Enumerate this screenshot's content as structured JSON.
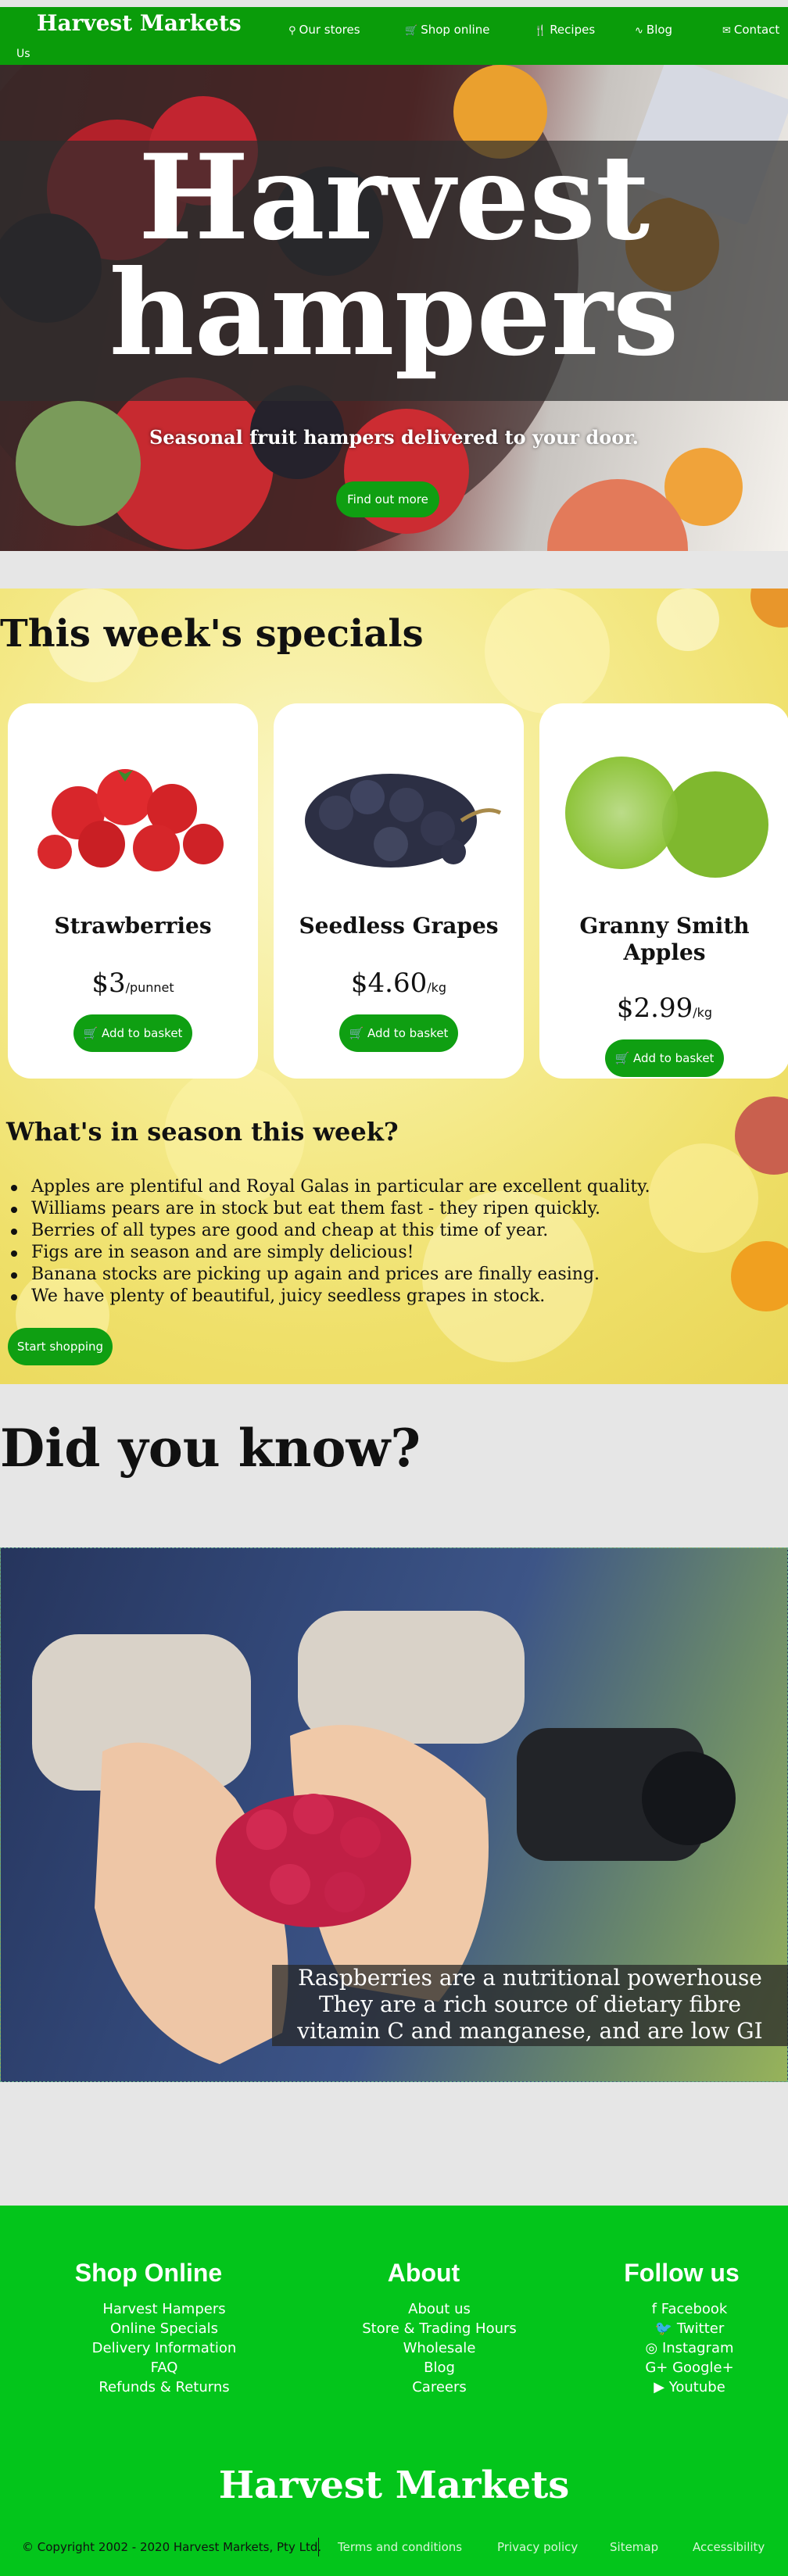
{
  "nav": {
    "brand": "Harvest Markets",
    "links": [
      {
        "label": "Our stores",
        "icon": "map-marker-icon",
        "glyph": "⚲"
      },
      {
        "label": "Shop online",
        "icon": "basket-icon",
        "glyph": "🛒"
      },
      {
        "label": "Recipes",
        "icon": "cutlery-icon",
        "glyph": "🍴"
      },
      {
        "label": "Blog",
        "icon": "rss-icon",
        "glyph": "∿"
      },
      {
        "label": "Contact",
        "icon": "envelope-icon",
        "glyph": "✉"
      }
    ],
    "contact_wrap": "Us"
  },
  "hero": {
    "title_line1": "Harvest",
    "title_line2": "hampers",
    "subtitle": "Seasonal fruit hampers delivered to your door.",
    "cta": "Find out more"
  },
  "specials": {
    "heading": "This week's specials",
    "cards": [
      {
        "name_line1": "Strawberries",
        "name_line2": "",
        "price": "$3",
        "unit": "/punnet",
        "button": "Add to basket"
      },
      {
        "name_line1": "Seedless Grapes",
        "name_line2": "",
        "price": "$4.60",
        "unit": "/kg",
        "button": "Add to basket"
      },
      {
        "name_line1": "Granny Smith",
        "name_line2": "Apples",
        "price": "$2.99",
        "unit": "/kg",
        "button": "Add to basket"
      }
    ]
  },
  "season": {
    "heading": "What's in season this week?",
    "items": [
      "Apples are plentiful and Royal Galas in particular are excellent quality.",
      "Williams pears are in stock but eat them fast - they ripen quickly.",
      "Berries of all types are good and cheap at this time of year.",
      "Figs are in season and are simply delicious!",
      "Banana stocks are picking up again and prices are finally easing.",
      "We have plenty of beautiful, juicy seedless grapes in stock."
    ],
    "cta": "Start shopping"
  },
  "did_you_know": {
    "heading": "Did you know?",
    "caption_lines": [
      "Raspberries are a nutritional powerhouse",
      "They are a rich source of dietary fibre",
      "vitamin C and manganese, and are low GI"
    ]
  },
  "footer": {
    "shop": {
      "heading": "Shop Online",
      "items": [
        "Harvest Hampers",
        "Online Specials",
        "Delivery Information",
        "FAQ",
        "Refunds & Returns"
      ]
    },
    "about": {
      "heading": "About",
      "items": [
        "About us",
        "Store & Trading Hours",
        "Wholesale",
        "Blog",
        "Careers"
      ]
    },
    "follow": {
      "heading": "Follow us",
      "items": [
        {
          "label": "Facebook",
          "icon": "facebook-icon",
          "glyph": "f"
        },
        {
          "label": "Twitter",
          "icon": "twitter-icon",
          "glyph": "🐦"
        },
        {
          "label": "Instagram",
          "icon": "instagram-icon",
          "glyph": "◎"
        },
        {
          "label": "Google+",
          "icon": "google-plus-icon",
          "glyph": "G+"
        },
        {
          "label": "Youtube",
          "icon": "youtube-icon",
          "glyph": "▶"
        }
      ]
    },
    "brand": "Harvest Markets",
    "copyright": "© Copyright 2002 - 2020 Harvest Markets, Pty Ltd.",
    "legal_links": [
      "Terms and conditions",
      "Privacy policy",
      "Sitemap",
      "Accessibility"
    ]
  },
  "colors": {
    "nav_green": "#0a9c0a",
    "button_green": "#0f9f12",
    "footer_green": "#03c51b"
  }
}
